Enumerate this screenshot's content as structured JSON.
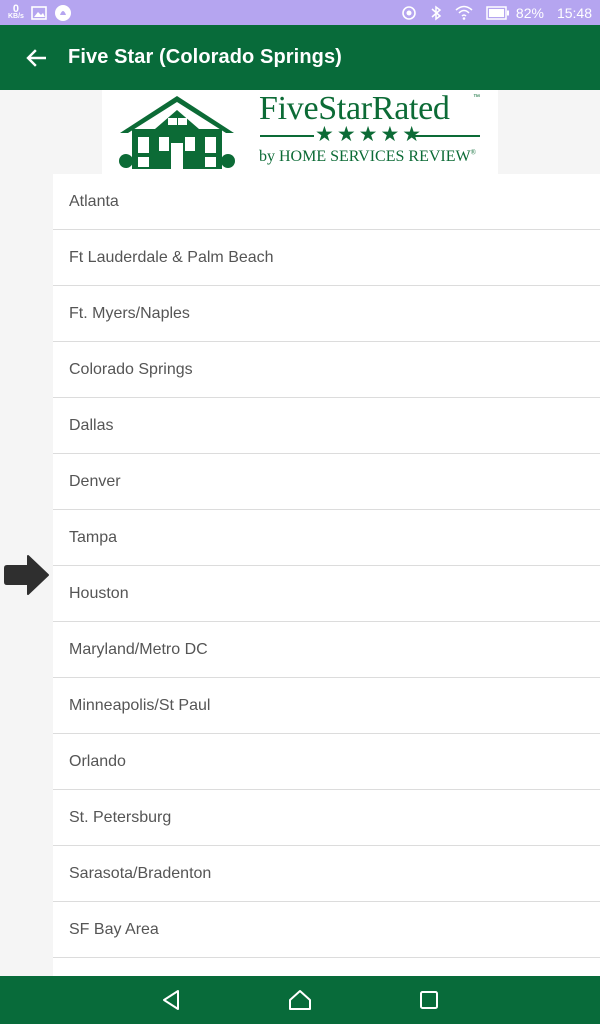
{
  "status_bar": {
    "net_speed_value": "0",
    "net_speed_unit": "KB/s",
    "battery_percent": "82%",
    "time": "15:48",
    "icons": [
      "gallery-icon",
      "notification-app-icon",
      "location-icon",
      "bluetooth-icon",
      "wifi-icon",
      "battery-icon"
    ]
  },
  "app_bar": {
    "title": "Five Star (Colorado Springs)",
    "back_icon": "arrow-left-icon"
  },
  "banner": {
    "brand_name": "FiveStarRated",
    "trademark": "™",
    "stars": "★★★★★",
    "byline_prefix": "by ",
    "byline_company": "HOME SERVICES REVIEW",
    "registered": "®"
  },
  "cities": [
    {
      "label": "Atlanta"
    },
    {
      "label": "Ft Lauderdale & Palm Beach"
    },
    {
      "label": "Ft. Myers/Naples"
    },
    {
      "label": "Colorado Springs"
    },
    {
      "label": "Dallas"
    },
    {
      "label": "Denver"
    },
    {
      "label": "Tampa"
    },
    {
      "label": "Houston"
    },
    {
      "label": "Maryland/Metro DC"
    },
    {
      "label": "Minneapolis/St Paul"
    },
    {
      "label": "Orlando"
    },
    {
      "label": "St. Petersburg"
    },
    {
      "label": "Sarasota/Bradenton"
    },
    {
      "label": "SF Bay Area"
    },
    {
      "label": ""
    }
  ],
  "nav_bar": {
    "buttons": [
      "back-triangle-icon",
      "home-icon",
      "recents-square-icon"
    ]
  },
  "colors": {
    "status_bar": "#b5a5f0",
    "app_bar": "#086b3a",
    "brand_green": "#0c6b36",
    "list_text": "#555555",
    "pointer_arrow": "#2f2f2f"
  }
}
